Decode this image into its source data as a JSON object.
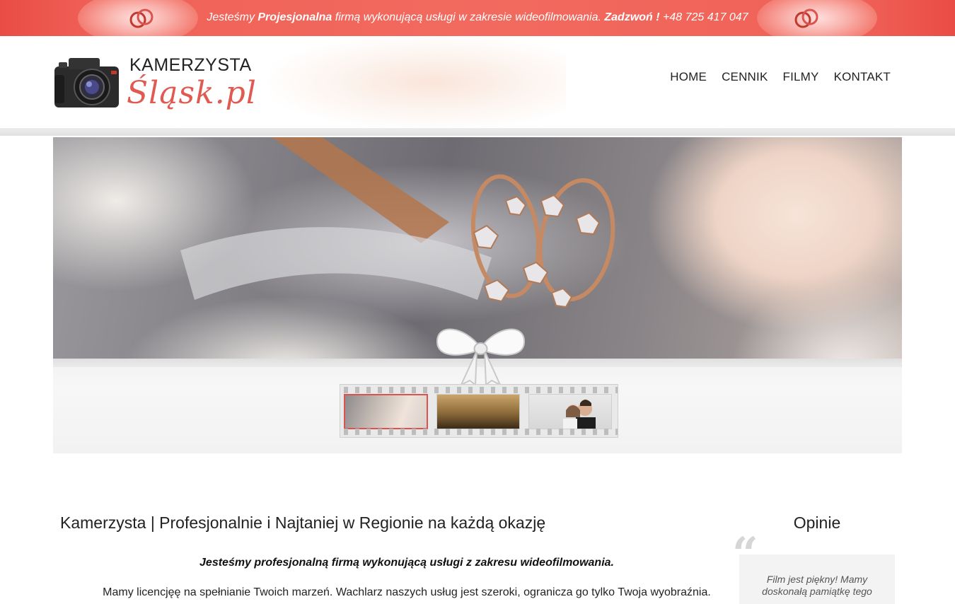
{
  "topbar": {
    "part1": "Jesteśmy ",
    "bold1": "Projesjonalna",
    "part2": " firmą wykonującą usługi w zakresie wideofilmowania. ",
    "bold2": "Zadzwoń !",
    "phone": " +48 725 417 047",
    "color": "#f0635a"
  },
  "logo": {
    "line1": "KAMERZYSTA",
    "line2": "Śląsk.pl",
    "accent": "#e05a52"
  },
  "nav": {
    "items": [
      "HOME",
      "CENNIK",
      "FILMY",
      "KONTAKT"
    ]
  },
  "slider": {
    "thumbnails": [
      "rings",
      "wedding-guests",
      "couple"
    ],
    "active_index": 0
  },
  "content": {
    "title": "Kamerzysta | Profesjonalnie i Najtaniej w Regionie na każdą okazję",
    "lead": "Jesteśmy profesjonalną firmą wykonującą usługi z zakresu wideofilmowania.",
    "body": "Mamy licencjęę na spełnianie Twoich marzeń. Wachlarz naszych usług jest szeroki, ogranicza go tylko Twoja wyobraźnia."
  },
  "sidebar": {
    "title": "Opinie",
    "quote_mark": "“",
    "testimonial": "Film jest piękny! Mamy doskonałą pamiątkę tego"
  }
}
